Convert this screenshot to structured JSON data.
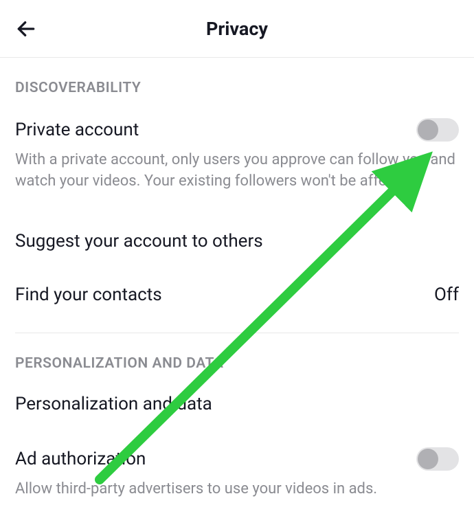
{
  "header": {
    "title": "Privacy"
  },
  "sections": {
    "discoverability": {
      "header": "DISCOVERABILITY",
      "private_account": {
        "label": "Private account",
        "desc": "With a private account, only users you approve can follow you and watch your videos. Your existing followers won't be affected.",
        "toggle_on": false
      },
      "suggest": {
        "label": "Suggest your account to others"
      },
      "find_contacts": {
        "label": "Find your contacts",
        "value": "Off"
      }
    },
    "personalization": {
      "header": "PERSONALIZATION AND DATA",
      "pd_row": {
        "label": "Personalization and data"
      },
      "ad_auth": {
        "label": "Ad authorization",
        "desc": "Allow third-party advertisers to use your videos in ads.",
        "toggle_on": false
      }
    }
  },
  "annotation": {
    "arrow_color": "#2ecc40"
  }
}
